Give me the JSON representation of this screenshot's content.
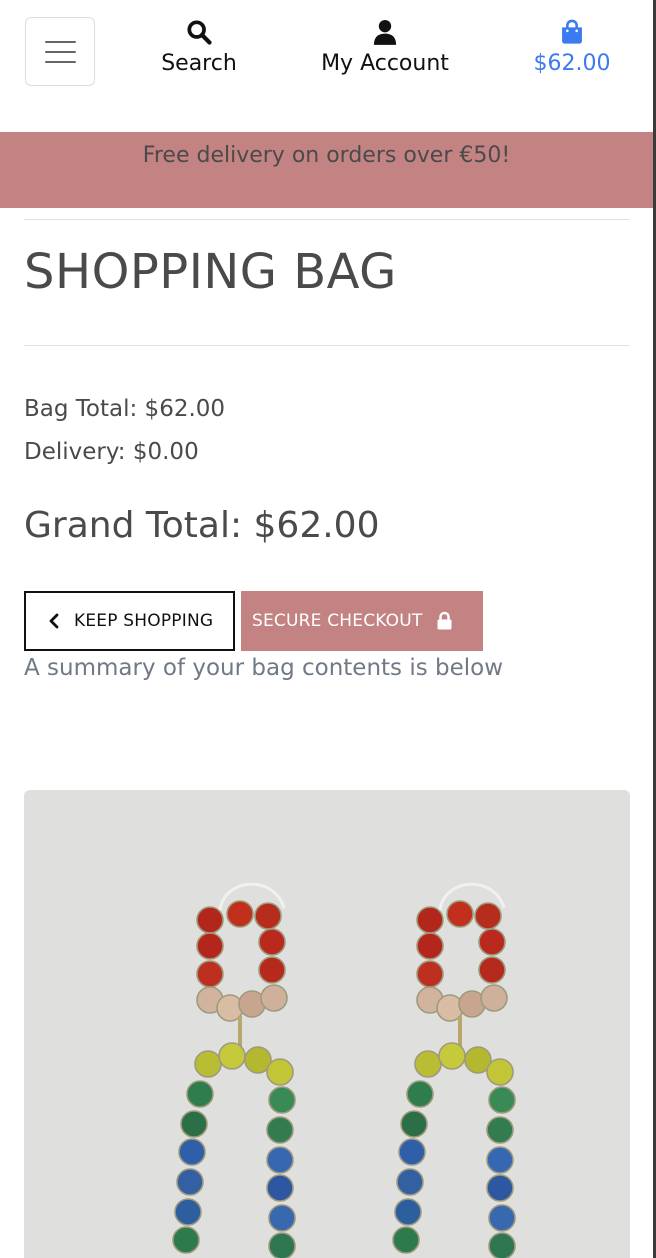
{
  "nav": {
    "search_label": "Search",
    "account_label": "My Account",
    "bag_total": "$62.00"
  },
  "banner": {
    "text": "Free delivery on orders over €50!"
  },
  "page": {
    "title": "SHOPPING BAG"
  },
  "summary": {
    "bag_total": "Bag Total: $62.00",
    "delivery": "Delivery: $0.00",
    "grand_total": "Grand Total: $62.00"
  },
  "buttons": {
    "keep_shopping": "KEEP SHOPPING",
    "secure_checkout": "SECURE CHECKOUT"
  },
  "note": "A summary of your bag contents is below",
  "colors": {
    "accent": "#c48383",
    "bag_link": "#3a7bef",
    "text": "#4a4a4a",
    "muted": "#707a86"
  },
  "icons": [
    "menu-icon",
    "search-icon",
    "user-icon",
    "shopping-bag-icon",
    "chevron-left-icon",
    "lock-icon"
  ],
  "product": {
    "image_subject": "rainbow rhinestone drop earrings"
  }
}
